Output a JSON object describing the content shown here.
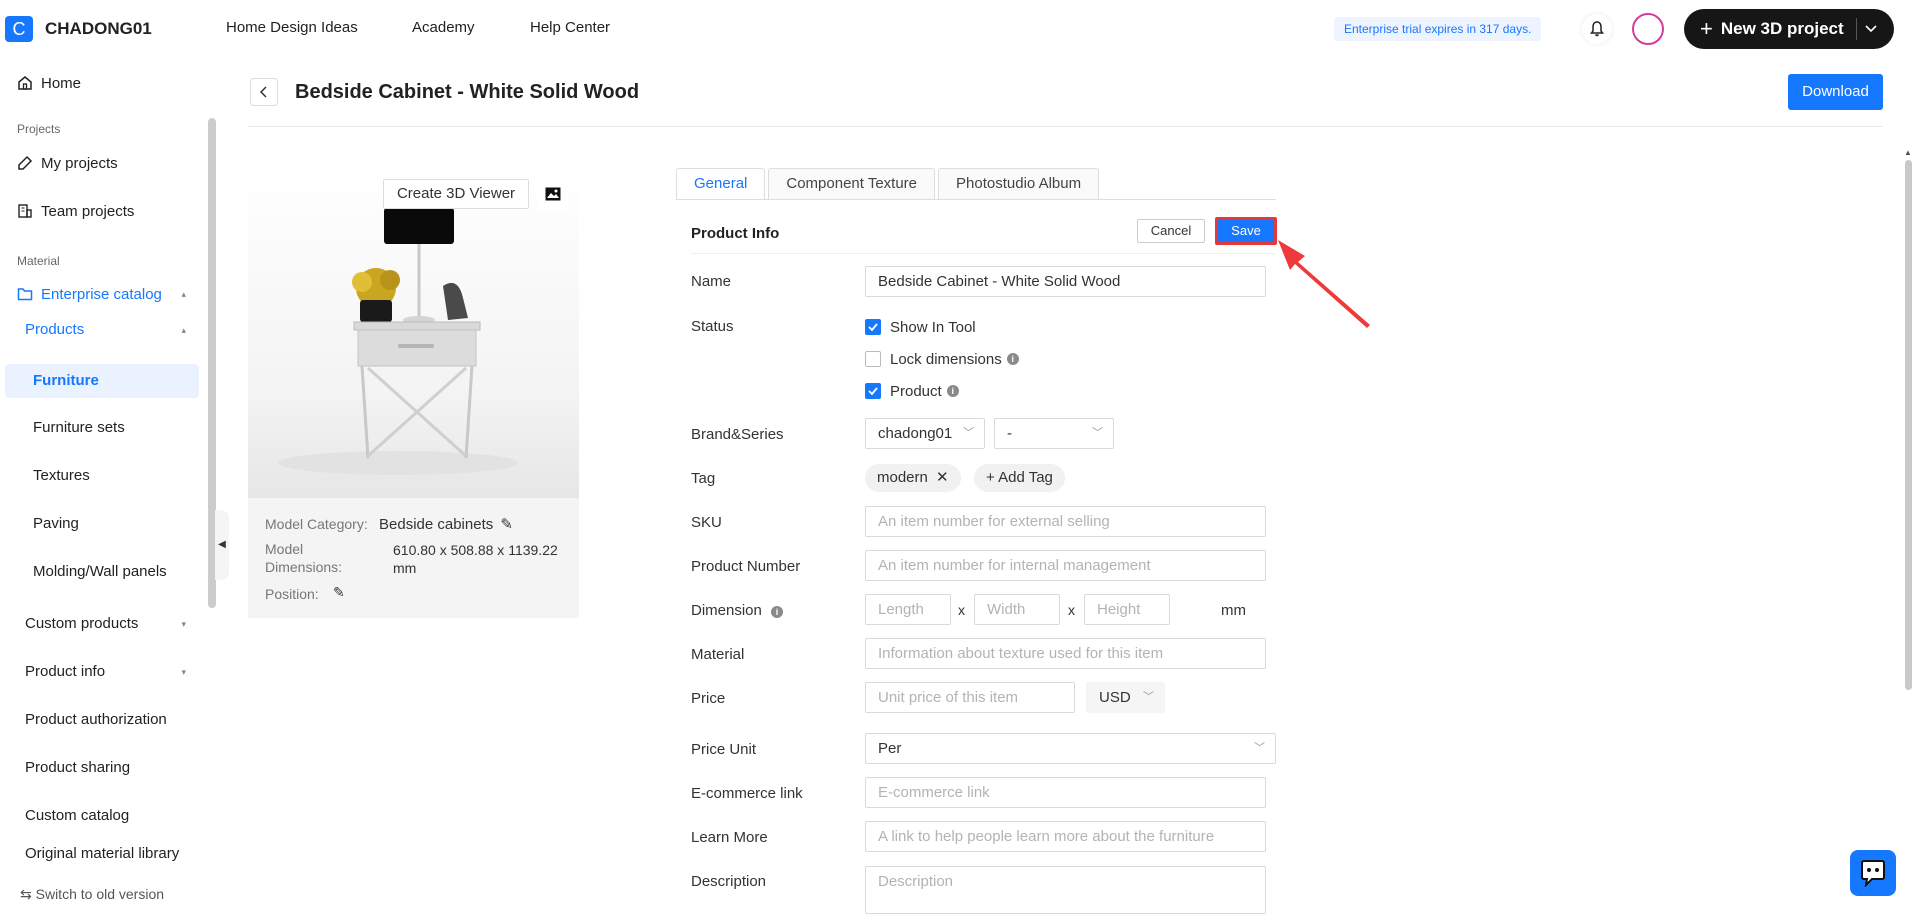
{
  "header": {
    "logo_letter": "C",
    "brand": "CHADONG01",
    "nav": [
      "Home Design Ideas",
      "Academy",
      "Help Center"
    ],
    "trial_notice": "Enterprise trial expires in 317 days.",
    "new_project_label": "New 3D project"
  },
  "sidebar": {
    "home": "Home",
    "section_projects": "Projects",
    "my_projects": "My projects",
    "team_projects": "Team projects",
    "section_material": "Material",
    "enterprise_catalog": "Enterprise catalog",
    "products": "Products",
    "furniture": "Furniture",
    "furniture_sets": "Furniture sets",
    "textures": "Textures",
    "paving": "Paving",
    "molding": "Molding/Wall panels",
    "custom_products": "Custom products",
    "product_info": "Product info",
    "product_authorization": "Product authorization",
    "product_sharing": "Product sharing",
    "custom_catalog": "Custom catalog",
    "original_material_library": "Original material library",
    "switch_old": "Switch to old version"
  },
  "page": {
    "title": "Bedside Cabinet - White Solid Wood",
    "download": "Download"
  },
  "preview": {
    "create_3d_viewer": "Create 3D Viewer",
    "model_category_label": "Model Category:",
    "model_category_value": "Bedside cabinets",
    "model_dimensions_label_1": "Model",
    "model_dimensions_label_2": "Dimensions:",
    "model_dimensions_value_1": "610.80 x 508.88 x 1139.22",
    "model_dimensions_value_2": "mm",
    "position_label": "Position:"
  },
  "tabs": [
    "General",
    "Component Texture",
    "Photostudio Album"
  ],
  "form": {
    "section_title": "Product Info",
    "cancel": "Cancel",
    "save": "Save",
    "name_label": "Name",
    "name_value": "Bedside Cabinet - White Solid Wood",
    "status_label": "Status",
    "show_in_tool": "Show In Tool",
    "lock_dimensions": "Lock dimensions",
    "product": "Product",
    "brand_label": "Brand&Series",
    "brand_value": "chadong01",
    "series_value": "-",
    "tag_label": "Tag",
    "tag_value": "modern",
    "add_tag": "Add Tag",
    "sku_label": "SKU",
    "sku_placeholder": "An item number for external selling",
    "product_number_label": "Product Number",
    "product_number_placeholder": "An item number for internal management",
    "dimension_label": "Dimension",
    "length_placeholder": "Length",
    "width_placeholder": "Width",
    "height_placeholder": "Height",
    "dimension_x": "x",
    "dimension_unit": "mm",
    "material_label": "Material",
    "material_placeholder": "Information about texture used for this item",
    "price_label": "Price",
    "price_placeholder": "Unit price of this item",
    "currency": "USD",
    "price_unit_label": "Price Unit",
    "price_unit_value": "Per",
    "ecommerce_label": "E-commerce link",
    "ecommerce_placeholder": "E-commerce link",
    "learn_more_label": "Learn More",
    "learn_more_placeholder": "A link to help people learn more about the furniture",
    "description_label": "Description",
    "description_placeholder": "Description"
  },
  "colors": {
    "accent": "#1677ff",
    "highlight": "#e5383b"
  }
}
